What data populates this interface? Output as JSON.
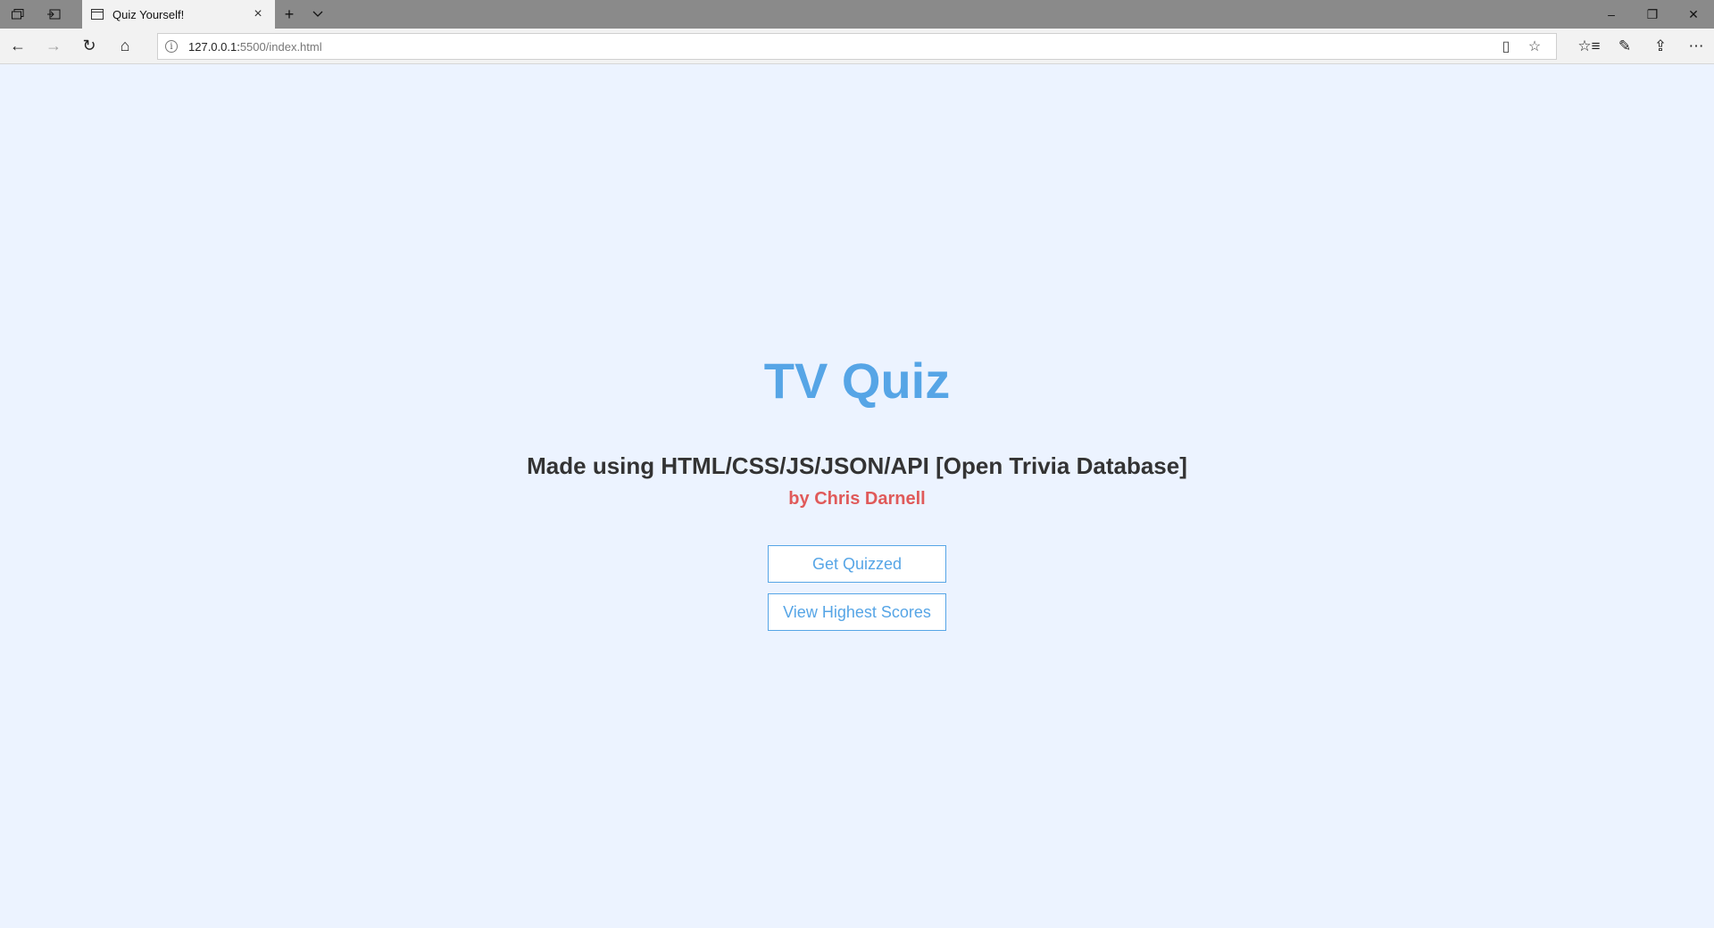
{
  "browser": {
    "tab": {
      "title": "Quiz Yourself!",
      "close_icon": "×"
    },
    "new_tab_icon": "+",
    "tab_menu_icon": "⌄",
    "window_controls": {
      "minimize": "–",
      "restore": "❐",
      "close": "✕"
    },
    "address": {
      "host": "127.0.0.1:",
      "path": "5500/index.html"
    },
    "icons": {
      "back": "←",
      "forward": "→",
      "refresh": "↻",
      "home": "⌂",
      "reading_view": "▯",
      "favorite": "☆",
      "favorites_hub": "☆≡",
      "notes": "✎",
      "share": "⇪",
      "more": "⋯"
    }
  },
  "page": {
    "title": "TV Quiz",
    "subtitle": "Made using HTML/CSS/JS/JSON/API [Open Trivia Database]",
    "author": "by Chris Darnell",
    "buttons": {
      "play": "Get Quizzed",
      "scores": "View Highest Scores"
    }
  },
  "colors": {
    "background": "#ecf3ff",
    "accent": "#56a5e6",
    "author": "#e05a5a"
  }
}
